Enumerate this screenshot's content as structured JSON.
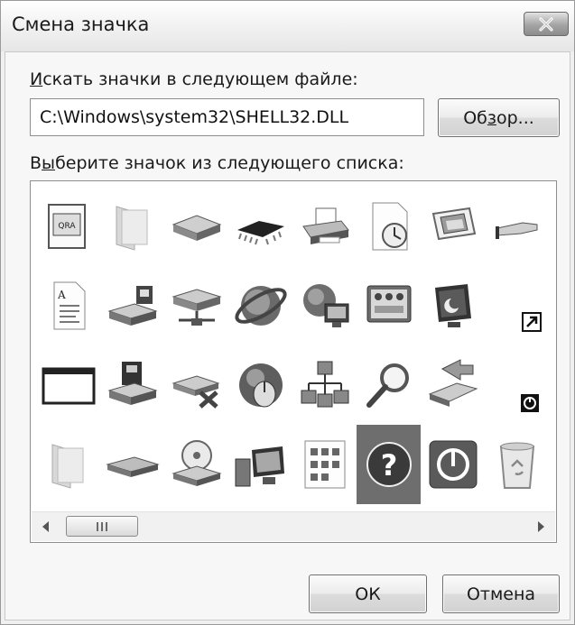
{
  "dialog": {
    "title": "Смена значка",
    "close_label": "×"
  },
  "file_section": {
    "label_accel": "И",
    "label_rest": "скать значки в следующем файле:",
    "path_value": "C:\\Windows\\system32\\SHELL32.DLL",
    "browse_pre": "Об",
    "browse_accel": "з",
    "browse_post": "ор..."
  },
  "icon_section": {
    "label_pre": "В",
    "label_accel": "ы",
    "label_rest": "берите значок из следующего списка:",
    "icons": [
      [
        "window-app-icon",
        "folder-icon",
        "drive-icon",
        "chip-icon",
        "printer-icon",
        "document-clock-icon",
        "display-frame-icon",
        "hand-share-icon"
      ],
      [
        "text-document-icon",
        "network-drive-icon",
        "network-server-icon",
        "internet-globe-icon",
        "globe-computer-icon",
        "control-panel-icon",
        "monitor-moon-icon",
        "shortcut-overlay-icon"
      ],
      [
        "empty-window-icon",
        "floppy-drive-icon",
        "disconnected-network-drive-icon",
        "mouse-globe-icon",
        "network-tree-icon",
        "magnifier-icon",
        "usb-arrow-icon",
        "power-overlay-icon"
      ],
      [
        "folder-2-icon",
        "flat-drive-icon",
        "cd-drive-icon",
        "computer-monitor-icon",
        "grid-document-icon",
        "help-question-icon",
        "power-button-icon",
        "recycle-bin-icon"
      ]
    ],
    "selected_row": 3,
    "selected_col": 5
  },
  "footer": {
    "ok_label": "ОК",
    "cancel_label": "Отмена"
  }
}
